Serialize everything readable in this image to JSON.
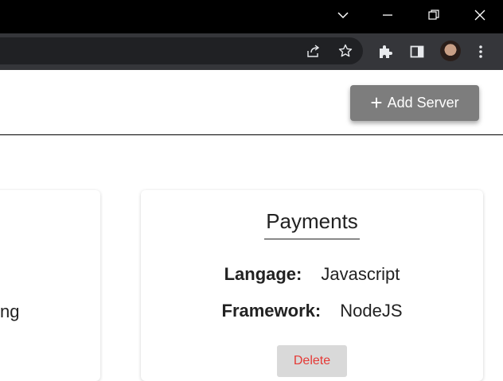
{
  "window": {
    "controls": {
      "tab_search_icon": "chevron-down-icon",
      "minimize_icon": "minimize-icon",
      "restore_icon": "restore-icon",
      "close_icon": "close-icon"
    }
  },
  "toolbar": {
    "icons": [
      "share-icon",
      "star-icon",
      "extensions-icon",
      "side-panel-icon",
      "avatar",
      "menu-icon"
    ]
  },
  "header": {
    "add_button_label": "Add Server",
    "add_button_icon": "plus-icon",
    "add_button_color": "#7d7d7d"
  },
  "cards": [
    {
      "partial_text": "ng"
    },
    {
      "title": "Payments",
      "fields": [
        {
          "label": "Langage:",
          "value": "Javascript"
        },
        {
          "label": "Framework:",
          "value": "NodeJS"
        }
      ],
      "delete_label": "Delete",
      "delete_color": "#e53935"
    }
  ]
}
